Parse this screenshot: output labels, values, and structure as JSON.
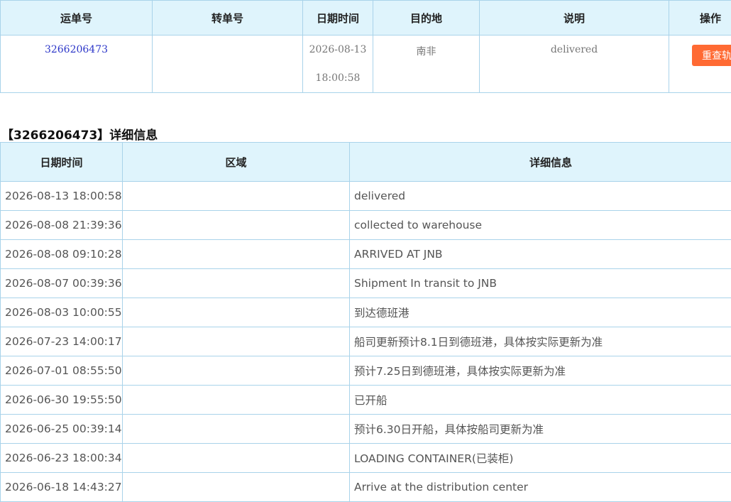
{
  "summary": {
    "headers": [
      "运单号",
      "转单号",
      "日期时间",
      "目的地",
      "说明",
      "操作"
    ],
    "row": {
      "tracking_no": "3266206473",
      "transfer_no": "",
      "datetime": "2026-08-13 18:00:58",
      "destination": "南非",
      "description": "delivered",
      "action_label": "重查轨迹"
    }
  },
  "detail": {
    "title": "【3266206473】详细信息",
    "headers": [
      "日期时间",
      "区域",
      "详细信息"
    ],
    "rows": [
      {
        "time": "2026-08-13 18:00:58",
        "area": "",
        "info": "delivered"
      },
      {
        "time": "2026-08-08 21:39:36",
        "area": "",
        "info": "collected to warehouse"
      },
      {
        "time": "2026-08-08 09:10:28",
        "area": "",
        "info": "ARRIVED AT JNB"
      },
      {
        "time": "2026-08-07 00:39:36",
        "area": "",
        "info": "Shipment In transit to JNB"
      },
      {
        "time": "2026-08-03 10:00:55",
        "area": "",
        "info": "到达德班港"
      },
      {
        "time": "2026-07-23 14:00:17",
        "area": "",
        "info": "船司更新预计8.1日到德班港，具体按实际更新为准"
      },
      {
        "time": "2026-07-01 08:55:50",
        "area": "",
        "info": "预计7.25日到德班港，具体按实际更新为准"
      },
      {
        "time": "2026-06-30 19:55:50",
        "area": "",
        "info": "已开船"
      },
      {
        "time": "2026-06-25 00:39:14",
        "area": "",
        "info": "预计6.30日开船，具体按船司更新为准"
      },
      {
        "time": "2026-06-23 18:00:34",
        "area": "",
        "info": "LOADING CONTAINER(已装柜)"
      },
      {
        "time": "2026-06-18 14:43:27",
        "area": "",
        "info": "Arrive at the distribution center"
      }
    ]
  }
}
